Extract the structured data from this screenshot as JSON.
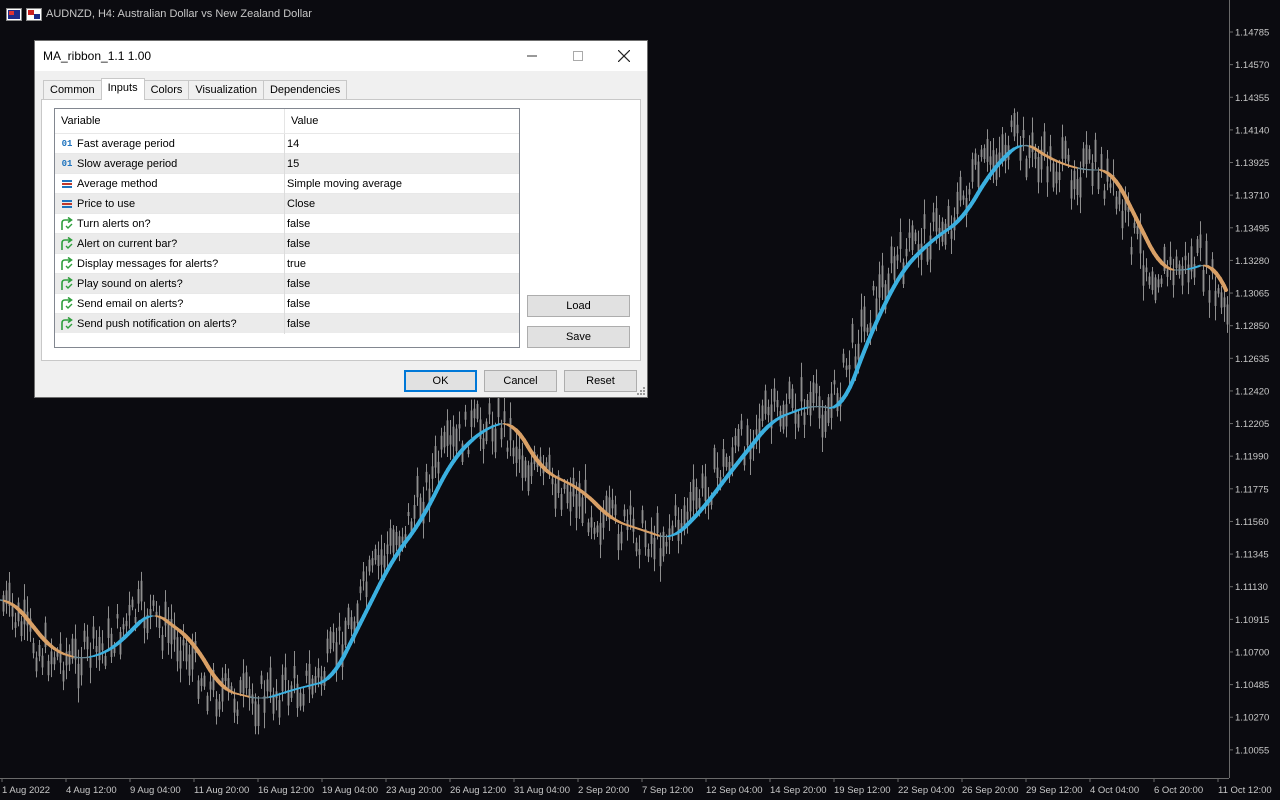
{
  "chart": {
    "symbol_title": "AUDNZD, H4:  Australian Dollar vs New Zealand Dollar",
    "price_labels": [
      "1.14785",
      "1.14570",
      "1.14355",
      "1.14140",
      "1.13925",
      "1.13710",
      "1.13495",
      "1.13280",
      "1.13065",
      "1.12850",
      "1.12635",
      "1.12420",
      "1.12205",
      "1.11990",
      "1.11775",
      "1.11560",
      "1.11345",
      "1.11130",
      "1.10915",
      "1.10700",
      "1.10485",
      "1.10270",
      "1.10055"
    ],
    "time_labels": [
      "1 Aug 2022",
      "4 Aug 12:00",
      "9 Aug 04:00",
      "11 Aug 20:00",
      "16 Aug 12:00",
      "19 Aug 04:00",
      "23 Aug 20:00",
      "26 Aug 12:00",
      "31 Aug 04:00",
      "2 Sep 20:00",
      "7 Sep 12:00",
      "12 Sep 04:00",
      "14 Sep 20:00",
      "19 Sep 12:00",
      "22 Sep 04:00",
      "26 Sep 20:00",
      "29 Sep 12:00",
      "4 Oct 04:00",
      "6 Oct 20:00",
      "11 Oct 12:00"
    ],
    "colors": {
      "background": "#0b0b10",
      "candles": "#8f8f8f",
      "ribbon_up": "#3bb0e0",
      "ribbon_down": "#d9a066",
      "ribbon_flat": "#6b8a96"
    }
  },
  "dialog": {
    "title": "MA_ribbon_1.1 1.00",
    "tabs": [
      "Common",
      "Inputs",
      "Colors",
      "Visualization",
      "Dependencies"
    ],
    "active_tab": "Inputs",
    "columns": {
      "variable": "Variable",
      "value": "Value"
    },
    "params": [
      {
        "icon": "int-icon",
        "name": "Fast average period",
        "value": "14"
      },
      {
        "icon": "int-icon",
        "name": "Slow average period",
        "value": "15"
      },
      {
        "icon": "enum-icon",
        "name": "Average method",
        "value": "Simple moving average"
      },
      {
        "icon": "enum-icon",
        "name": "Price to use",
        "value": "Close"
      },
      {
        "icon": "bool-icon",
        "name": "Turn alerts on?",
        "value": "false"
      },
      {
        "icon": "bool-icon",
        "name": "Alert on current bar?",
        "value": "false"
      },
      {
        "icon": "bool-icon",
        "name": "Display messages for alerts?",
        "value": "true"
      },
      {
        "icon": "bool-icon",
        "name": "Play sound on alerts?",
        "value": "false"
      },
      {
        "icon": "bool-icon",
        "name": "Send email on alerts?",
        "value": "false"
      },
      {
        "icon": "bool-icon",
        "name": "Send push notification on alerts?",
        "value": "false"
      }
    ],
    "buttons": {
      "load": "Load",
      "save": "Save",
      "ok": "OK",
      "cancel": "Cancel",
      "reset": "Reset"
    }
  }
}
